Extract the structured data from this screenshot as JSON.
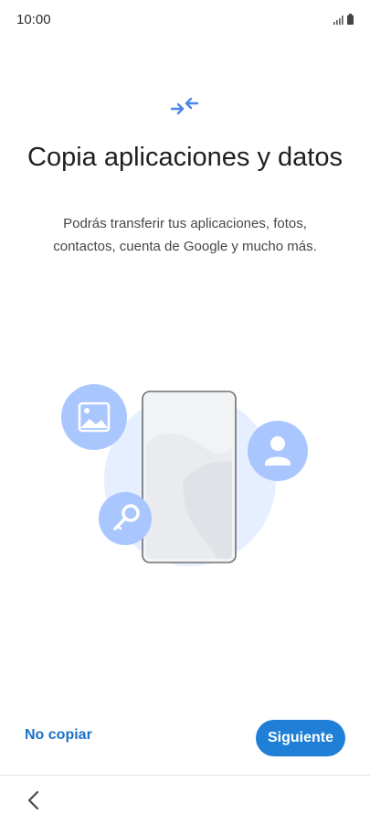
{
  "status_bar": {
    "time": "10:00",
    "icons": [
      "signal-icon",
      "battery-icon"
    ]
  },
  "header": {
    "icon": "transfer-arrows-icon",
    "title": "Copia aplicaciones y datos",
    "subtitle": "Podrás transferir tus aplicaciones, fotos, contactos, cuenta de Google y mucho más."
  },
  "illustration": {
    "items": [
      "image-icon",
      "contact-icon",
      "key-icon",
      "phone"
    ]
  },
  "actions": {
    "skip_label": "No copiar",
    "next_label": "Siguiente"
  },
  "nav": {
    "back_icon": "chevron-left-icon"
  },
  "colors": {
    "accent": "#1f7fd6",
    "link": "#1a73c8",
    "icon_blue": "#4a86e8",
    "bubble": "#a9c6ff",
    "halo": "#e6efff"
  }
}
